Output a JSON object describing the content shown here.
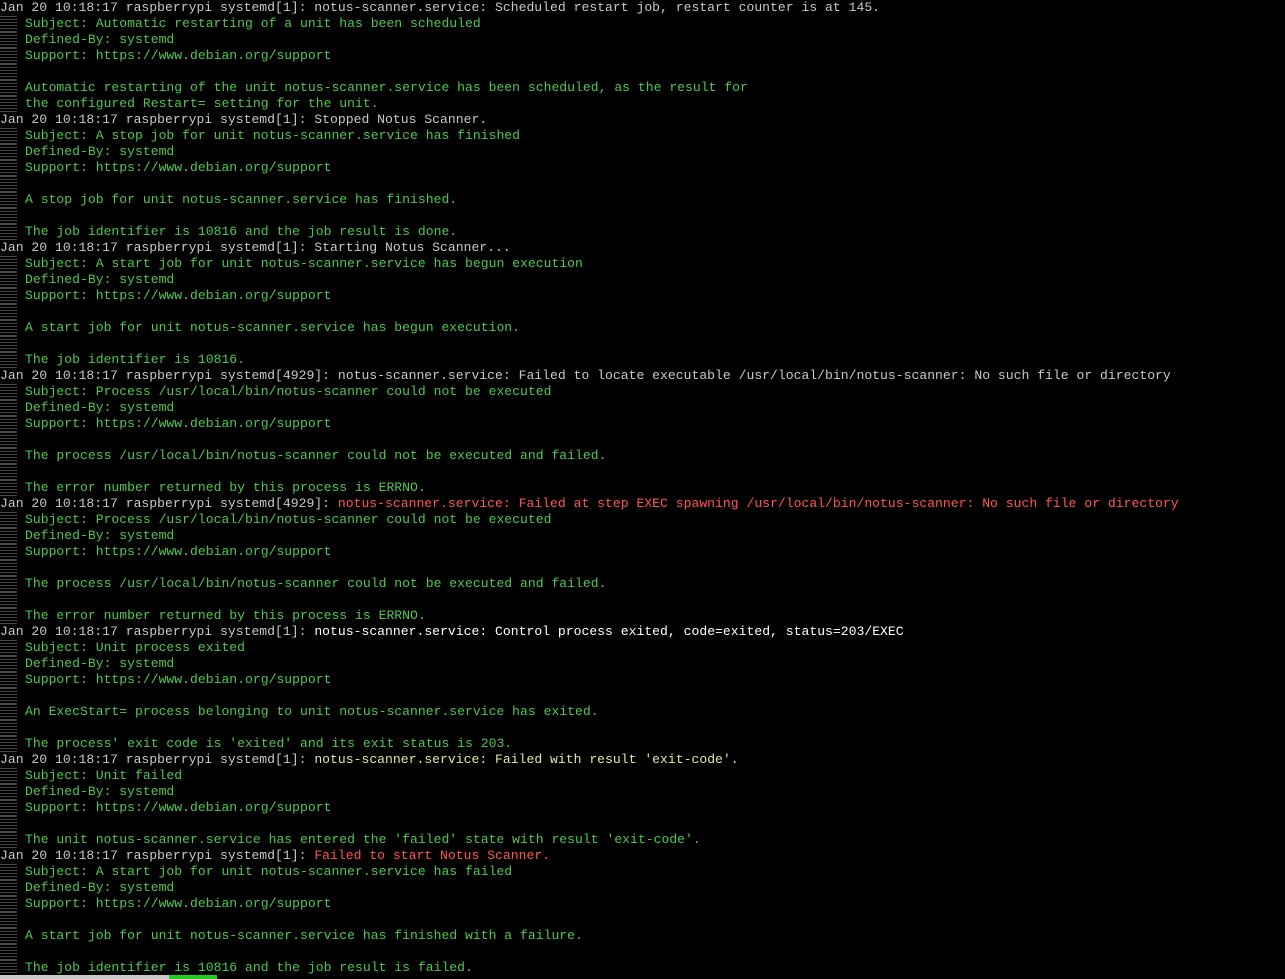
{
  "app": {
    "type": "terminal",
    "colors": {
      "background": "#000000",
      "normal": "#c8c8c8",
      "green": "#4ec94e",
      "white": "#ffffff",
      "yellow": "#e6e6a0",
      "red": "#ff5555"
    }
  },
  "lines": [
    {
      "margin": false,
      "segments": [
        {
          "text": "Jan 20 10:18:17 raspberrypi systemd[1]: notus-scanner.service: Scheduled restart job, restart counter is at 145.",
          "color": "normal"
        }
      ]
    },
    {
      "margin": true,
      "segments": [
        {
          "text": "Subject: Automatic restarting of a unit has been scheduled",
          "color": "green"
        }
      ]
    },
    {
      "margin": true,
      "segments": [
        {
          "text": "Defined-By: systemd",
          "color": "green"
        }
      ]
    },
    {
      "margin": true,
      "segments": [
        {
          "text": "Support: https://www.debian.org/support",
          "color": "green"
        }
      ]
    },
    {
      "margin": true,
      "segments": [
        {
          "text": "",
          "color": "green"
        }
      ]
    },
    {
      "margin": true,
      "segments": [
        {
          "text": "Automatic restarting of the unit notus-scanner.service has been scheduled, as the result for",
          "color": "green"
        }
      ]
    },
    {
      "margin": true,
      "segments": [
        {
          "text": "the configured Restart= setting for the unit.",
          "color": "green"
        }
      ]
    },
    {
      "margin": false,
      "segments": [
        {
          "text": "Jan 20 10:18:17 raspberrypi systemd[1]: Stopped Notus Scanner.",
          "color": "normal"
        }
      ]
    },
    {
      "margin": true,
      "segments": [
        {
          "text": "Subject: A stop job for unit notus-scanner.service has finished",
          "color": "green"
        }
      ]
    },
    {
      "margin": true,
      "segments": [
        {
          "text": "Defined-By: systemd",
          "color": "green"
        }
      ]
    },
    {
      "margin": true,
      "segments": [
        {
          "text": "Support: https://www.debian.org/support",
          "color": "green"
        }
      ]
    },
    {
      "margin": true,
      "segments": [
        {
          "text": "",
          "color": "green"
        }
      ]
    },
    {
      "margin": true,
      "segments": [
        {
          "text": "A stop job for unit notus-scanner.service has finished.",
          "color": "green"
        }
      ]
    },
    {
      "margin": true,
      "segments": [
        {
          "text": "",
          "color": "green"
        }
      ]
    },
    {
      "margin": true,
      "segments": [
        {
          "text": "The job identifier is 10816 and the job result is done.",
          "color": "green"
        }
      ]
    },
    {
      "margin": false,
      "segments": [
        {
          "text": "Jan 20 10:18:17 raspberrypi systemd[1]: Starting Notus Scanner...",
          "color": "normal"
        }
      ]
    },
    {
      "margin": true,
      "segments": [
        {
          "text": "Subject: A start job for unit notus-scanner.service has begun execution",
          "color": "green"
        }
      ]
    },
    {
      "margin": true,
      "segments": [
        {
          "text": "Defined-By: systemd",
          "color": "green"
        }
      ]
    },
    {
      "margin": true,
      "segments": [
        {
          "text": "Support: https://www.debian.org/support",
          "color": "green"
        }
      ]
    },
    {
      "margin": true,
      "segments": [
        {
          "text": "",
          "color": "green"
        }
      ]
    },
    {
      "margin": true,
      "segments": [
        {
          "text": "A start job for unit notus-scanner.service has begun execution.",
          "color": "green"
        }
      ]
    },
    {
      "margin": true,
      "segments": [
        {
          "text": "",
          "color": "green"
        }
      ]
    },
    {
      "margin": true,
      "segments": [
        {
          "text": "The job identifier is 10816.",
          "color": "green"
        }
      ]
    },
    {
      "margin": false,
      "segments": [
        {
          "text": "Jan 20 10:18:17 raspberrypi systemd[4929]: notus-scanner.service: Failed to locate executable /usr/local/bin/notus-scanner: No such file or directory",
          "color": "normal"
        }
      ]
    },
    {
      "margin": true,
      "segments": [
        {
          "text": "Subject: Process /usr/local/bin/notus-scanner could not be executed",
          "color": "green"
        }
      ]
    },
    {
      "margin": true,
      "segments": [
        {
          "text": "Defined-By: systemd",
          "color": "green"
        }
      ]
    },
    {
      "margin": true,
      "segments": [
        {
          "text": "Support: https://www.debian.org/support",
          "color": "green"
        }
      ]
    },
    {
      "margin": true,
      "segments": [
        {
          "text": "",
          "color": "green"
        }
      ]
    },
    {
      "margin": true,
      "segments": [
        {
          "text": "The process /usr/local/bin/notus-scanner could not be executed and failed.",
          "color": "green"
        }
      ]
    },
    {
      "margin": true,
      "segments": [
        {
          "text": "",
          "color": "green"
        }
      ]
    },
    {
      "margin": true,
      "segments": [
        {
          "text": "The error number returned by this process is ERRNO.",
          "color": "green"
        }
      ]
    },
    {
      "margin": false,
      "segments": [
        {
          "text": "Jan 20 10:18:17 raspberrypi systemd[4929]: ",
          "color": "normal"
        },
        {
          "text": "notus-scanner.service: Failed at step EXEC spawning /usr/local/bin/notus-scanner: No such file or directory",
          "color": "red"
        }
      ]
    },
    {
      "margin": true,
      "segments": [
        {
          "text": "Subject: Process /usr/local/bin/notus-scanner could not be executed",
          "color": "green"
        }
      ]
    },
    {
      "margin": true,
      "segments": [
        {
          "text": "Defined-By: systemd",
          "color": "green"
        }
      ]
    },
    {
      "margin": true,
      "segments": [
        {
          "text": "Support: https://www.debian.org/support",
          "color": "green"
        }
      ]
    },
    {
      "margin": true,
      "segments": [
        {
          "text": "",
          "color": "green"
        }
      ]
    },
    {
      "margin": true,
      "segments": [
        {
          "text": "The process /usr/local/bin/notus-scanner could not be executed and failed.",
          "color": "green"
        }
      ]
    },
    {
      "margin": true,
      "segments": [
        {
          "text": "",
          "color": "green"
        }
      ]
    },
    {
      "margin": true,
      "segments": [
        {
          "text": "The error number returned by this process is ERRNO.",
          "color": "green"
        }
      ]
    },
    {
      "margin": false,
      "segments": [
        {
          "text": "Jan 20 10:18:17 raspberrypi systemd[1]: ",
          "color": "normal"
        },
        {
          "text": "notus-scanner.service: Control process exited, code=exited, status=203/EXEC",
          "color": "white"
        }
      ]
    },
    {
      "margin": true,
      "segments": [
        {
          "text": "Subject: Unit process exited",
          "color": "green"
        }
      ]
    },
    {
      "margin": true,
      "segments": [
        {
          "text": "Defined-By: systemd",
          "color": "green"
        }
      ]
    },
    {
      "margin": true,
      "segments": [
        {
          "text": "Support: https://www.debian.org/support",
          "color": "green"
        }
      ]
    },
    {
      "margin": true,
      "segments": [
        {
          "text": "",
          "color": "green"
        }
      ]
    },
    {
      "margin": true,
      "segments": [
        {
          "text": "An ExecStart= process belonging to unit notus-scanner.service has exited.",
          "color": "green"
        }
      ]
    },
    {
      "margin": true,
      "segments": [
        {
          "text": "",
          "color": "green"
        }
      ]
    },
    {
      "margin": true,
      "segments": [
        {
          "text": "The process' exit code is 'exited' and its exit status is 203.",
          "color": "green"
        }
      ]
    },
    {
      "margin": false,
      "segments": [
        {
          "text": "Jan 20 10:18:17 raspberrypi systemd[1]: ",
          "color": "normal"
        },
        {
          "text": "notus-scanner.service: Failed with result 'exit-code'.",
          "color": "yellow"
        }
      ]
    },
    {
      "margin": true,
      "segments": [
        {
          "text": "Subject: Unit failed",
          "color": "green"
        }
      ]
    },
    {
      "margin": true,
      "segments": [
        {
          "text": "Defined-By: systemd",
          "color": "green"
        }
      ]
    },
    {
      "margin": true,
      "segments": [
        {
          "text": "Support: https://www.debian.org/support",
          "color": "green"
        }
      ]
    },
    {
      "margin": true,
      "segments": [
        {
          "text": "",
          "color": "green"
        }
      ]
    },
    {
      "margin": true,
      "segments": [
        {
          "text": "The unit notus-scanner.service has entered the 'failed' state with result 'exit-code'.",
          "color": "green"
        }
      ]
    },
    {
      "margin": false,
      "segments": [
        {
          "text": "Jan 20 10:18:17 raspberrypi systemd[1]: ",
          "color": "normal"
        },
        {
          "text": "Failed to start Notus Scanner.",
          "color": "red"
        }
      ]
    },
    {
      "margin": true,
      "segments": [
        {
          "text": "Subject: A start job for unit notus-scanner.service has failed",
          "color": "green"
        }
      ]
    },
    {
      "margin": true,
      "segments": [
        {
          "text": "Defined-By: systemd",
          "color": "green"
        }
      ]
    },
    {
      "margin": true,
      "segments": [
        {
          "text": "Support: https://www.debian.org/support",
          "color": "green"
        }
      ]
    },
    {
      "margin": true,
      "segments": [
        {
          "text": "",
          "color": "green"
        }
      ]
    },
    {
      "margin": true,
      "segments": [
        {
          "text": "A start job for unit notus-scanner.service has finished with a failure.",
          "color": "green"
        }
      ]
    },
    {
      "margin": true,
      "segments": [
        {
          "text": "",
          "color": "green"
        }
      ]
    },
    {
      "margin": true,
      "segments": [
        {
          "text": "The job identifier is 10816 and the job result is failed.",
          "color": "green"
        }
      ]
    }
  ]
}
